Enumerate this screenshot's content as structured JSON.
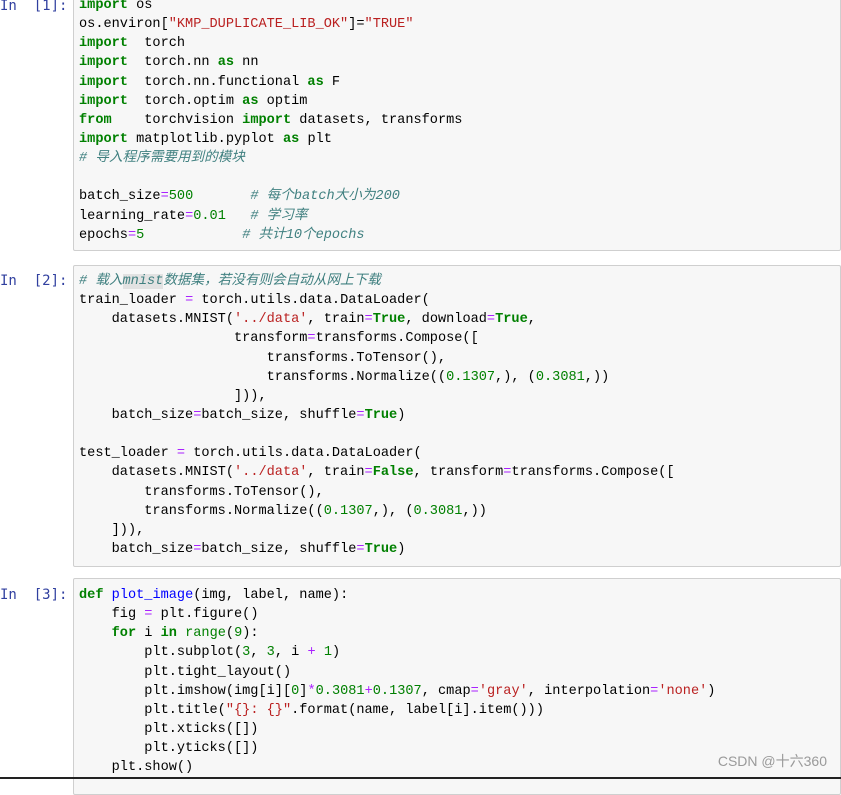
{
  "cells": [
    {
      "prompt": "In  [1]:",
      "lines": [
        [
          [
            "kw",
            "import"
          ],
          [
            "t",
            " os"
          ]
        ],
        [
          [
            "t",
            "os.environ["
          ],
          [
            "str",
            "\"KMP_DUPLICATE_LIB_OK\""
          ],
          [
            "t",
            "]="
          ],
          [
            "str",
            "\"TRUE\""
          ]
        ],
        [
          [
            "kw",
            "import"
          ],
          [
            "t",
            "  torch"
          ]
        ],
        [
          [
            "kw",
            "import"
          ],
          [
            "t",
            "  torch.nn "
          ],
          [
            "kw",
            "as"
          ],
          [
            "t",
            " nn"
          ]
        ],
        [
          [
            "kw",
            "import"
          ],
          [
            "t",
            "  torch.nn.functional "
          ],
          [
            "kw",
            "as"
          ],
          [
            "t",
            " F"
          ]
        ],
        [
          [
            "kw",
            "import"
          ],
          [
            "t",
            "  torch.optim "
          ],
          [
            "kw",
            "as"
          ],
          [
            "t",
            " optim"
          ]
        ],
        [
          [
            "kw",
            "from"
          ],
          [
            "t",
            "    torchvision "
          ],
          [
            "kw",
            "import"
          ],
          [
            "t",
            " datasets, transforms"
          ]
        ],
        [
          [
            "kw",
            "import"
          ],
          [
            "t",
            " matplotlib.pyplot "
          ],
          [
            "kw",
            "as"
          ],
          [
            "t",
            " plt"
          ]
        ],
        [
          [
            "cm",
            "# 导入程序需要用到的模块"
          ]
        ],
        [
          [
            "t",
            ""
          ]
        ],
        [
          [
            "t",
            "batch_size"
          ],
          [
            "op",
            "="
          ],
          [
            "num",
            "500"
          ],
          [
            "t",
            "       "
          ],
          [
            "cm",
            "# 每个batch大小为200"
          ]
        ],
        [
          [
            "t",
            "learning_rate"
          ],
          [
            "op",
            "="
          ],
          [
            "num",
            "0.01"
          ],
          [
            "t",
            "   "
          ],
          [
            "cm",
            "# 学习率"
          ]
        ],
        [
          [
            "t",
            "epochs"
          ],
          [
            "op",
            "="
          ],
          [
            "num",
            "5"
          ],
          [
            "t",
            "            "
          ],
          [
            "cm",
            "# 共计10个epochs"
          ]
        ]
      ]
    },
    {
      "prompt": "In  [2]:",
      "lines": [
        [
          [
            "cm",
            "# 载入"
          ],
          [
            "cmhl",
            "mnist"
          ],
          [
            "cm",
            "数据集，若没有则会自动从网上下载"
          ]
        ],
        [
          [
            "t",
            "train_loader "
          ],
          [
            "op",
            "="
          ],
          [
            "t",
            " torch.utils.data.DataLoader("
          ]
        ],
        [
          [
            "t",
            "    datasets.MNIST("
          ],
          [
            "str",
            "'../data'"
          ],
          [
            "t",
            ", train"
          ],
          [
            "op",
            "="
          ],
          [
            "kw",
            "True"
          ],
          [
            "t",
            ", download"
          ],
          [
            "op",
            "="
          ],
          [
            "kw",
            "True"
          ],
          [
            "t",
            ","
          ]
        ],
        [
          [
            "t",
            "                   transform"
          ],
          [
            "op",
            "="
          ],
          [
            "t",
            "transforms.Compose(["
          ]
        ],
        [
          [
            "t",
            "                       transforms.ToTensor(),"
          ]
        ],
        [
          [
            "t",
            "                       transforms.Normalize(("
          ],
          [
            "num",
            "0.1307"
          ],
          [
            "t",
            ",), ("
          ],
          [
            "num",
            "0.3081"
          ],
          [
            "t",
            ",))"
          ]
        ],
        [
          [
            "t",
            "                   ])),"
          ]
        ],
        [
          [
            "t",
            "    batch_size"
          ],
          [
            "op",
            "="
          ],
          [
            "t",
            "batch_size, shuffle"
          ],
          [
            "op",
            "="
          ],
          [
            "kw",
            "True"
          ],
          [
            "t",
            ")"
          ]
        ],
        [
          [
            "t",
            ""
          ]
        ],
        [
          [
            "t",
            "test_loader "
          ],
          [
            "op",
            "="
          ],
          [
            "t",
            " torch.utils.data.DataLoader("
          ]
        ],
        [
          [
            "t",
            "    datasets.MNIST("
          ],
          [
            "str",
            "'../data'"
          ],
          [
            "t",
            ", train"
          ],
          [
            "op",
            "="
          ],
          [
            "kw",
            "False"
          ],
          [
            "t",
            ", transform"
          ],
          [
            "op",
            "="
          ],
          [
            "t",
            "transforms.Compose(["
          ]
        ],
        [
          [
            "t",
            "        transforms.ToTensor(),"
          ]
        ],
        [
          [
            "t",
            "        transforms.Normalize(("
          ],
          [
            "num",
            "0.1307"
          ],
          [
            "t",
            ",), ("
          ],
          [
            "num",
            "0.3081"
          ],
          [
            "t",
            ",))"
          ]
        ],
        [
          [
            "t",
            "    ])),"
          ]
        ],
        [
          [
            "t",
            "    batch_size"
          ],
          [
            "op",
            "="
          ],
          [
            "t",
            "batch_size, shuffle"
          ],
          [
            "op",
            "="
          ],
          [
            "kw",
            "True"
          ],
          [
            "t",
            ")"
          ]
        ]
      ]
    },
    {
      "prompt": "In  [3]:",
      "lines": [
        [
          [
            "kw",
            "def"
          ],
          [
            "t",
            " "
          ],
          [
            "fn",
            "plot_image"
          ],
          [
            "t",
            "(img, label, name):"
          ]
        ],
        [
          [
            "t",
            "    fig "
          ],
          [
            "op",
            "="
          ],
          [
            "t",
            " plt.figure()"
          ]
        ],
        [
          [
            "t",
            "    "
          ],
          [
            "kw",
            "for"
          ],
          [
            "t",
            " i "
          ],
          [
            "kw",
            "in"
          ],
          [
            "t",
            " "
          ],
          [
            "bi",
            "range"
          ],
          [
            "t",
            "("
          ],
          [
            "num",
            "9"
          ],
          [
            "t",
            "):"
          ]
        ],
        [
          [
            "t",
            "        plt.subplot("
          ],
          [
            "num",
            "3"
          ],
          [
            "t",
            ", "
          ],
          [
            "num",
            "3"
          ],
          [
            "t",
            ", i "
          ],
          [
            "op",
            "+"
          ],
          [
            "t",
            " "
          ],
          [
            "num",
            "1"
          ],
          [
            "t",
            ")"
          ]
        ],
        [
          [
            "t",
            "        plt.tight_layout()"
          ]
        ],
        [
          [
            "t",
            "        plt.imshow(img[i]["
          ],
          [
            "num",
            "0"
          ],
          [
            "t",
            "]"
          ],
          [
            "op",
            "*"
          ],
          [
            "num",
            "0.3081"
          ],
          [
            "op",
            "+"
          ],
          [
            "num",
            "0.1307"
          ],
          [
            "t",
            ", cmap"
          ],
          [
            "op",
            "="
          ],
          [
            "str",
            "'gray'"
          ],
          [
            "t",
            ", interpolation"
          ],
          [
            "op",
            "="
          ],
          [
            "str",
            "'none'"
          ],
          [
            "t",
            ")"
          ]
        ],
        [
          [
            "t",
            "        plt.title("
          ],
          [
            "str",
            "\"{}: {}\""
          ],
          [
            "t",
            ".format(name, label[i].item()))"
          ]
        ],
        [
          [
            "t",
            "        plt.xticks([])"
          ]
        ],
        [
          [
            "t",
            "        plt.yticks([])"
          ]
        ],
        [
          [
            "t",
            "    plt.show()"
          ]
        ]
      ]
    }
  ],
  "watermark": "CSDN @十六360"
}
